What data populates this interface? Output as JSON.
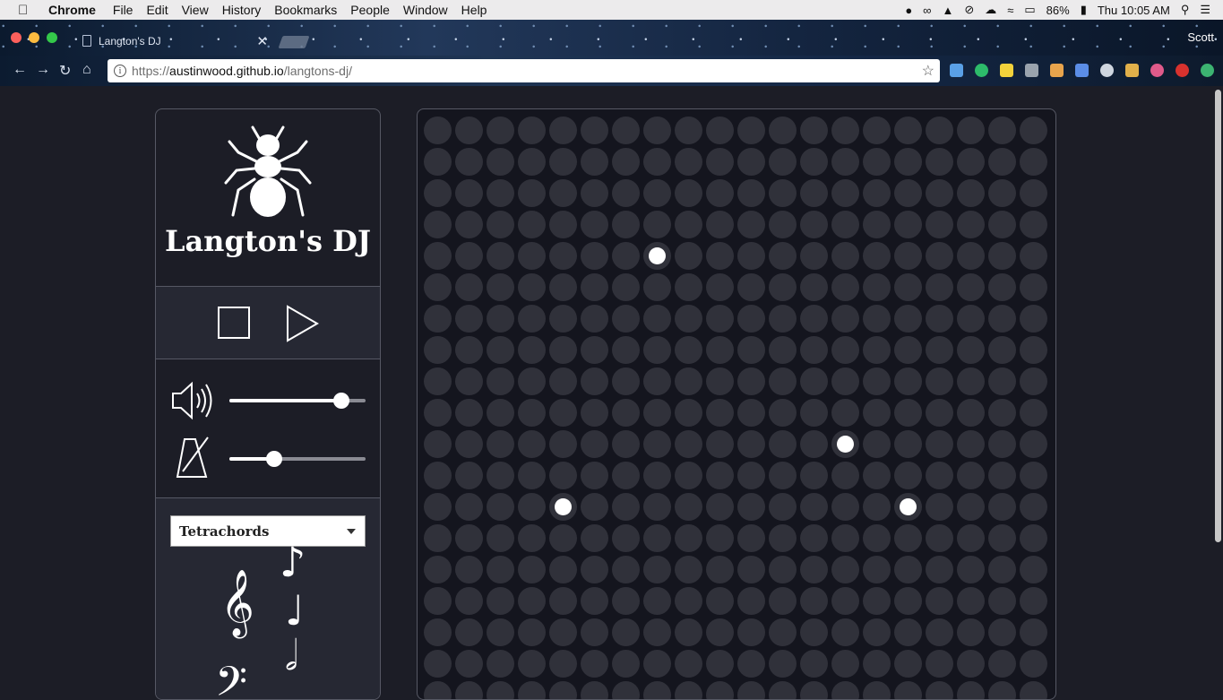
{
  "menubar": {
    "app_name": "Chrome",
    "items": [
      "File",
      "Edit",
      "View",
      "History",
      "Bookmarks",
      "People",
      "Window",
      "Help"
    ],
    "battery": "86%",
    "clock": "Thu 10:05 AM"
  },
  "browser": {
    "tab_title": "Langton's DJ",
    "profile": "Scott",
    "url_scheme": "https://",
    "url_host": "austinwood.github.io",
    "url_path": "/langtons-dj/"
  },
  "app": {
    "title": "Langton's DJ",
    "volume": 0.82,
    "tempo": 0.33,
    "scale_select": {
      "selected": "Tetrachords"
    },
    "grid": {
      "columns": 20,
      "rows": 19,
      "ants": [
        {
          "row": 4,
          "col": 7
        },
        {
          "row": 10,
          "col": 13
        },
        {
          "row": 12,
          "col": 4
        },
        {
          "row": 12,
          "col": 15
        }
      ]
    },
    "colors": {
      "background": "#1c1d26",
      "cell": "#30313a",
      "ant": "#ffffff",
      "border": "#565864"
    }
  }
}
